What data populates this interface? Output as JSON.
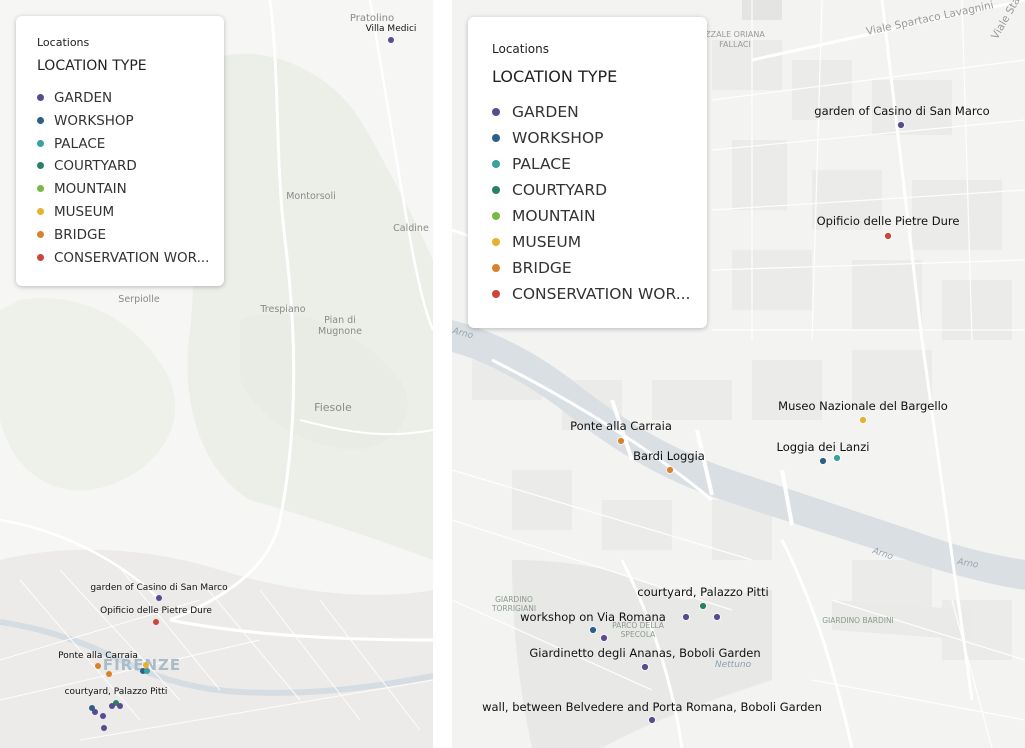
{
  "legend": {
    "title": "Locations",
    "subtitle": "LOCATION TYPE",
    "items": [
      {
        "label": "GARDEN",
        "color": "#5a4a90"
      },
      {
        "label": "WORKSHOP",
        "color": "#2f5f86"
      },
      {
        "label": "PALACE",
        "color": "#3aa0a0"
      },
      {
        "label": "COURTYARD",
        "color": "#2a8060"
      },
      {
        "label": "MOUNTAIN",
        "color": "#7ab648"
      },
      {
        "label": "MUSEUM",
        "color": "#e6b030"
      },
      {
        "label": "BRIDGE",
        "color": "#d9822b"
      },
      {
        "label": "CONSERVATION WOR...",
        "color": "#c9463d"
      }
    ]
  },
  "left_map": {
    "place_labels": {
      "pratolino": "Pratolino",
      "montorsoli": "Montorsoli",
      "caldine": "Caldine",
      "serpiolle": "Serpiolle",
      "trespiano": "Trespiano",
      "pian_di_mugnone_1": "Pian di",
      "pian_di_mugnone_2": "Mugnone",
      "fiesole": "Fiesole",
      "firenze": "FIRENZE"
    },
    "poi_labels": {
      "villa_medici": "Villa Medici",
      "garden_casino": "garden of Casino di San Marco",
      "opificio": "Opificio delle Pietre Dure",
      "ponte_carraia": "Ponte alla Carraia",
      "courtyard_pitti": "courtyard, Palazzo Pitti"
    }
  },
  "right_map": {
    "place_labels": {
      "viale_lavagnini": "Viale Spartaco Lavagnini",
      "viale_2": "Viale Sta",
      "fortezza_1": "ZZALE ORIANA",
      "fortezza_2": "FALLACI",
      "giardino_torrigiani_1": "GIARDINO",
      "giardino_torrigiani_2": "TORRIGIANI",
      "parco_specola_1": "PARCO DELLA",
      "parco_specola_2": "SPECOLA",
      "giardino_bardini": "GIARDINO BARDINI",
      "nettuno": "Nettuno",
      "arno_1": "Arno",
      "arno_2": "Arno",
      "arno_3": "Arno"
    },
    "poi_labels": {
      "garden_casino": "garden of Casino di San Marco",
      "opificio": "Opificio delle Pietre Dure",
      "bargello": "Museo Nazionale del Bargello",
      "ponte_carraia": "Ponte alla Carraia",
      "loggia_lanzi": "Loggia dei Lanzi",
      "bardi_loggia": "Bardi Loggia",
      "courtyard_pitti": "courtyard, Palazzo Pitti",
      "workshop_romana": "workshop on Via Romana",
      "giardinetto": "Giardinetto degli Ananas, Boboli Garden",
      "wall_belvedere": "wall, between Belvedere and Porta Romana, Boboli Garden"
    }
  }
}
